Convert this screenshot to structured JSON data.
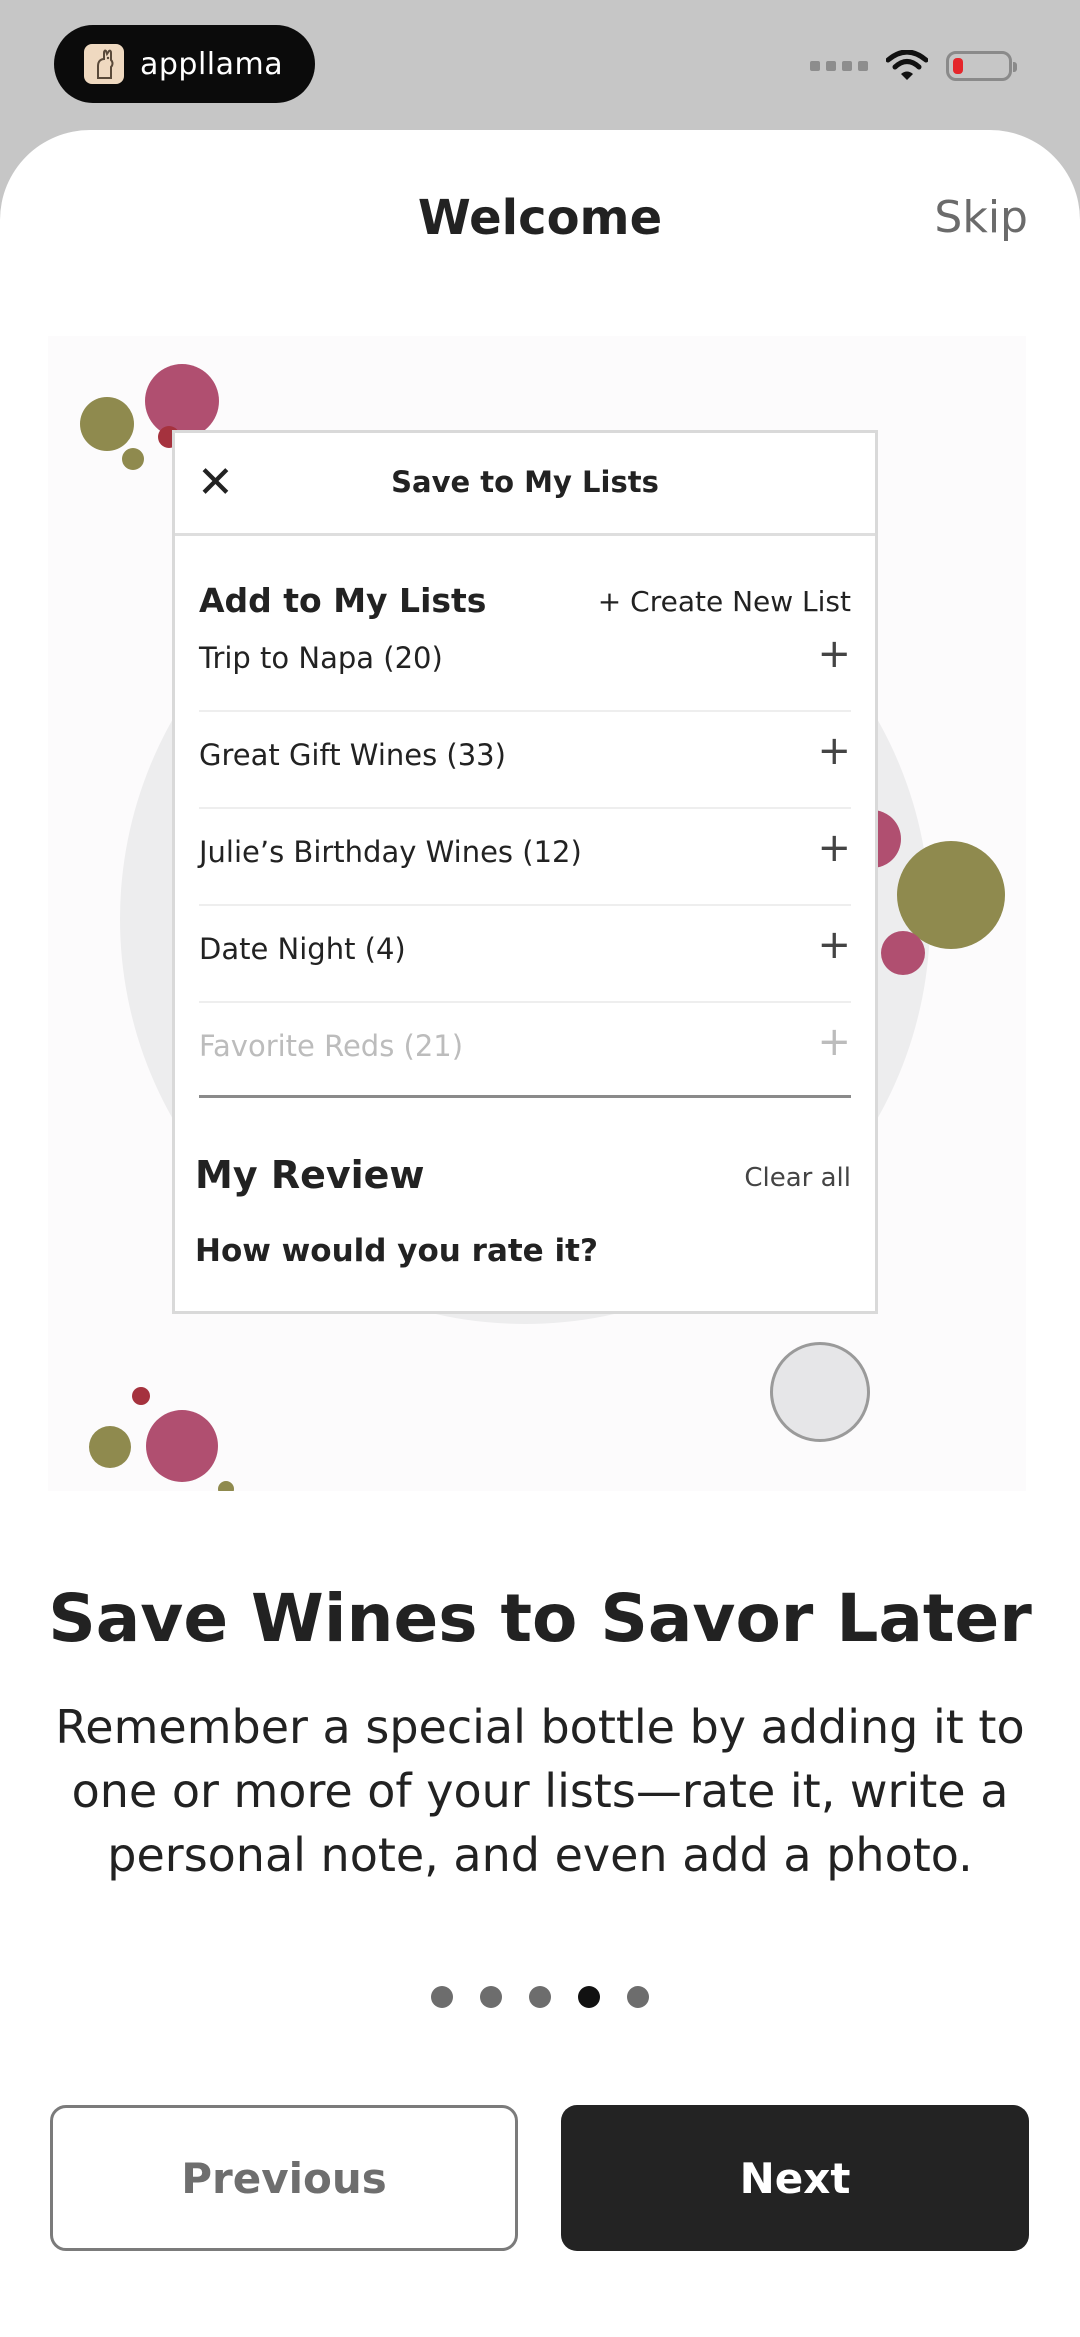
{
  "status_bar": {
    "brand_name": "appllama",
    "battery_color": "#e5262b"
  },
  "header": {
    "title": "Welcome",
    "skip_label": "Skip"
  },
  "illustration": {
    "dialog_title": "Save to My Lists",
    "lists_heading": "Add to My Lists",
    "create_new_label": "+ Create New List",
    "lists": [
      {
        "label": "Trip to Napa (20)"
      },
      {
        "label": "Great Gift Wines (33)"
      },
      {
        "label": "Julie’s Birthday Wines (12)"
      },
      {
        "label": "Date Night (4)"
      },
      {
        "label": "Favorite Reds (21)"
      }
    ],
    "review_heading": "My Review",
    "clear_all_label": "Clear all",
    "rate_prompt": "How would you rate it?",
    "accent_colors": {
      "wine": "#b04f70",
      "olive": "#8f8a4e",
      "red": "#a5323e"
    }
  },
  "content": {
    "headline": "Save Wines to Savor Later",
    "description": "Remember a special bottle by adding it to one or more of your lists—rate it, write a personal note, and even add a photo."
  },
  "pager": {
    "total": 5,
    "active_index": 3
  },
  "buttons": {
    "previous_label": "Previous",
    "next_label": "Next"
  }
}
